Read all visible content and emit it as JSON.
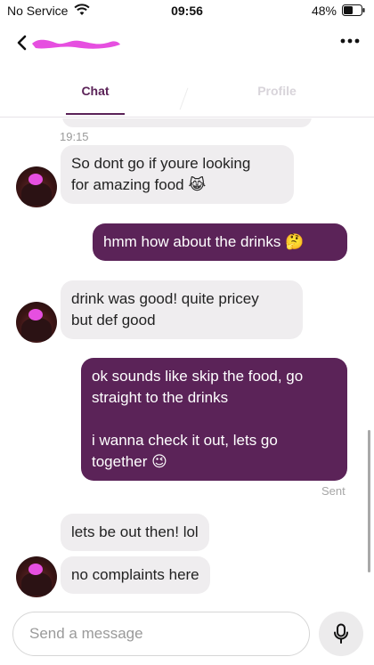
{
  "status_bar": {
    "carrier": "No Service",
    "time": "09:56",
    "battery": "48%",
    "wifi_icon": "wifi-icon",
    "battery_icon": "battery-icon"
  },
  "header": {
    "back_icon": "chevron-left-icon",
    "name": "",
    "more_icon": "more-horizontal-icon"
  },
  "tabs": {
    "chat": "Chat",
    "profile": "Profile",
    "active": "Chat"
  },
  "messages": {
    "timestamp": "19:15",
    "items": [
      {
        "direction": "in",
        "text": "So dont go if youre looking\nfor amazing food 😹"
      },
      {
        "direction": "out",
        "text": "hmm how about the drinks 🤔"
      },
      {
        "direction": "in",
        "text": "drink was good! quite pricey\nbut def good"
      },
      {
        "direction": "out",
        "text": "ok sounds like skip the food, go\nstraight to the drinks\n\ni wanna check it out, lets go\ntogether 😉"
      },
      {
        "direction": "in",
        "text": "lets be out then! lol"
      },
      {
        "direction": "in",
        "text": "no complaints here"
      }
    ],
    "sent_status": "Sent"
  },
  "composer": {
    "placeholder": "Send a message",
    "value": "",
    "mic_icon": "microphone-icon"
  },
  "colors": {
    "accent": "#5b2358",
    "incoming_bubble": "#efedef",
    "redaction": "#e64fe0"
  }
}
